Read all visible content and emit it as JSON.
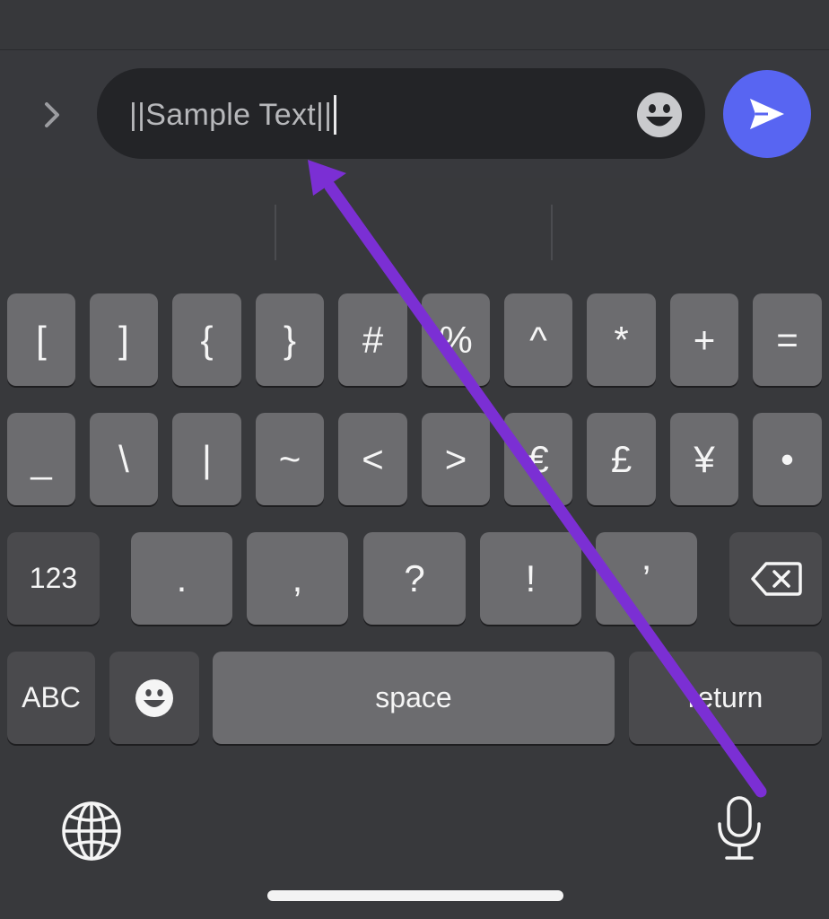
{
  "composer": {
    "input_value": "||Sample Text||",
    "input_placeholder": "",
    "expand_icon": "chevron-right-icon",
    "emoji_icon": "smiley-face-icon",
    "send_icon": "paper-plane-icon",
    "send_color": "#5865f2"
  },
  "keyboard": {
    "row1": [
      "[",
      "]",
      "{",
      "}",
      "#",
      "%",
      "^",
      "*",
      "+",
      "="
    ],
    "row2": [
      "_",
      "\\",
      "|",
      "~",
      "<",
      ">",
      "€",
      "£",
      "¥",
      "•"
    ],
    "row3": {
      "mode_key": "123",
      "punctuation": [
        ".",
        ",",
        "?",
        "!",
        "’"
      ],
      "delete_icon": "backspace-icon"
    },
    "row4": {
      "abc_key": "ABC",
      "emoji_icon": "smiley-face-icon",
      "space_key": "space",
      "return_key": "return"
    },
    "bottom": {
      "globe_icon": "globe-icon",
      "mic_icon": "microphone-icon"
    }
  },
  "annotation": {
    "arrow_color": "#7b2fd4"
  }
}
